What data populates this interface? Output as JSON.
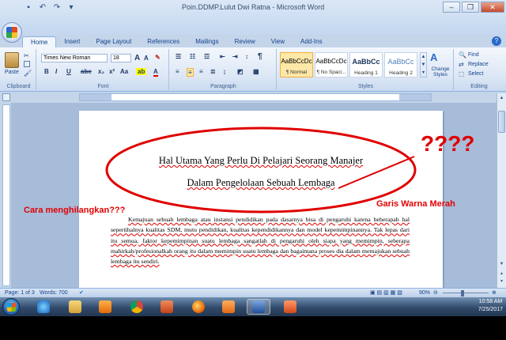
{
  "window": {
    "title": "Poin.DDMP.Lulut Dwi Ratna - Microsoft Word",
    "controls": [
      "–",
      "❐",
      "✕"
    ]
  },
  "ribbon_tabs": [
    "Home",
    "Insert",
    "Page Layout",
    "References",
    "Mailings",
    "Review",
    "View",
    "Add-Ins"
  ],
  "ribbon": {
    "clipboard": {
      "paste_label": "Paste",
      "group_label": "Clipboard"
    },
    "font": {
      "name": "Times New Roman",
      "size": "18",
      "group_label": "Font"
    },
    "paragraph": {
      "group_label": "Paragraph"
    },
    "styles": {
      "group_label": "Styles",
      "items": [
        {
          "sample": "AaBbCcDc",
          "name": "¶ Normal"
        },
        {
          "sample": "AaBbCcDc",
          "name": "¶ No Spaci..."
        },
        {
          "sample": "AaBbCc",
          "name": "Heading 1"
        },
        {
          "sample": "AaBbCc",
          "name": "Heading 2"
        }
      ],
      "change_styles": "Change Styles"
    },
    "editing": {
      "find": "Find",
      "replace": "Replace",
      "select": "Select",
      "group_label": "Editing"
    }
  },
  "document": {
    "title_line1": "Hal Utama Yang Perlu Di Pelajari Seorang Manajer",
    "title_line2": "Dalam Pengelolaan Sebuah Lembaga",
    "body": "Kemajuan sebuah lembaga atau instansi pendidikan pada dasarnya bisa di pengaruhi karena beberapah hal sepertihalnya kualitas SDM, mutu pendidikan, kualitas kependidikannya dan model kepemimpinannya. Tak lepas dari itu semua, faktor kepemimpinan suatu lembaga sangatlah di pengaruhi oleh siapa yang memimpin, seberapa mahirkah/profesionalkah orang itu dalam memimpin suatu lembaga dan bagaimana proses dia dalam memajukan sebuah lembaga itu sendiri."
  },
  "annotations": {
    "question_marks": "????",
    "left_note": "Cara menghilangkan???",
    "right_note": "Garis Warna Merah",
    "color": "#e00000"
  },
  "statusbar": {
    "page": "Page: 1 of 3",
    "words": "Words: 700",
    "zoom": "90%"
  },
  "taskbar": {
    "time": "10:58 AM",
    "date": "7/25/2017"
  }
}
